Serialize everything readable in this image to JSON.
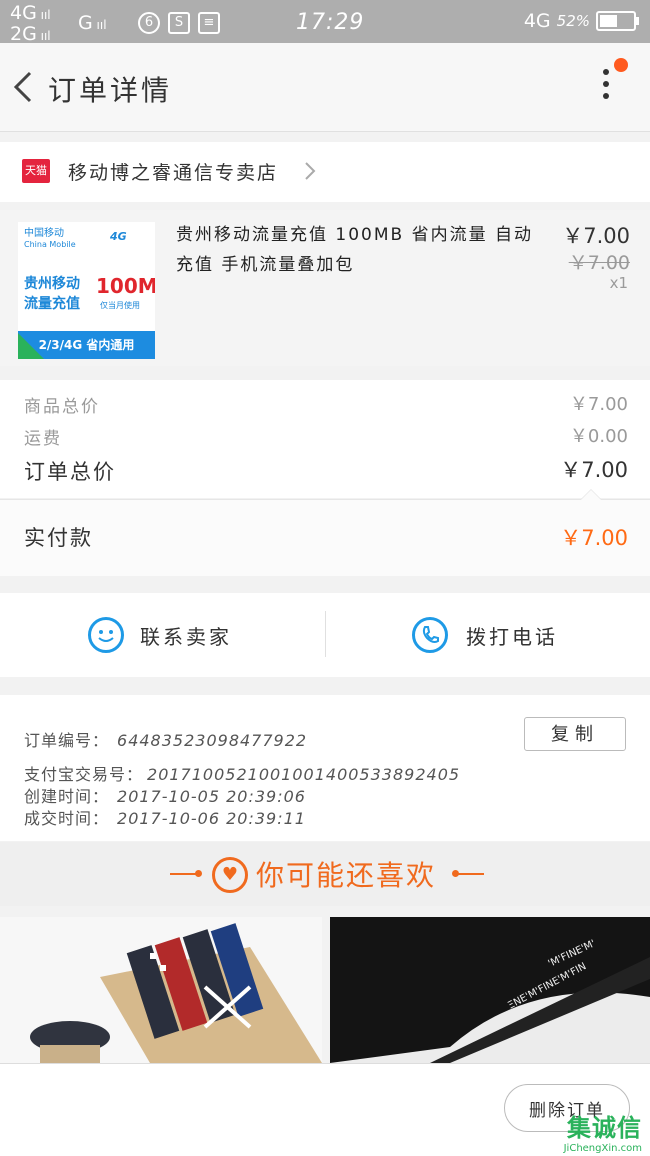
{
  "status_bar": {
    "sig1_top": "4G",
    "sig1_bottom": "2G",
    "sig2": "G",
    "time": "17:29",
    "network_right": "4G",
    "battery": "52%"
  },
  "header": {
    "title": "订单详情",
    "back_icon": "chevron-left-icon",
    "more_icon": "more-vertical-icon"
  },
  "store": {
    "badge": "天猫",
    "name": "移动博之睿通信专卖店"
  },
  "product": {
    "thumb": {
      "brand": "中国移动",
      "brand_en": "China Mobile",
      "network": "4G",
      "line1": "贵州移动",
      "line2": "流量充值",
      "size": "100M",
      "note": "仅当月使用",
      "band": "2/3/4G 省内通用"
    },
    "title": "贵州移动流量充值 100MB 省内流量 自动充值 手机流量叠加包",
    "price": "￥7.00",
    "original_price": "￥7.00",
    "quantity": "x1"
  },
  "totals": {
    "goods_label": "商品总价",
    "goods_value": "￥7.00",
    "shipping_label": "运费",
    "shipping_value": "￥0.00",
    "order_label": "订单总价",
    "order_value": "￥7.00",
    "paid_label": "实付款",
    "paid_value": "￥7.00"
  },
  "contact": {
    "seller_label": "联系卖家",
    "call_label": "拨打电话"
  },
  "order_info": {
    "order_no_label": "订单编号：",
    "order_no": "64483523098477922",
    "copy_label": "复制",
    "alipay_label": "支付宝交易号：",
    "alipay_no": "2017100521001001400533892405",
    "created_label": "创建时间：",
    "created": "2017-10-05 20:39:06",
    "deal_label": "成交时间：",
    "deal": "2017-10-06 20:39:11"
  },
  "recommend": {
    "title": "你可能还喜欢"
  },
  "bottom": {
    "delete_label": "删除订单"
  },
  "watermark": {
    "text": "集诚信",
    "url": "JiChengXin.com"
  },
  "colors": {
    "accent_orange": "#f06a1e",
    "price_orange": "#ff6a14",
    "link_blue": "#1e9ae6",
    "tmall_red": "#e4243e"
  }
}
